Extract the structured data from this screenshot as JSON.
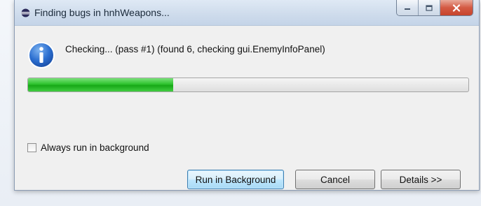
{
  "window": {
    "title": "Finding bugs in hnhWeapons..."
  },
  "dialog": {
    "message": "Checking... (pass #1) (found 6, checking gui.EnemyInfoPanel)",
    "progress_fraction": 0.33,
    "progress_color": "#22b522",
    "icon": "info-icon"
  },
  "options": {
    "background_checkbox_label": "Always run in background",
    "background_checkbox_checked": false
  },
  "buttons": {
    "run_background": "Run in Background",
    "cancel": "Cancel",
    "details": "Details >>"
  }
}
